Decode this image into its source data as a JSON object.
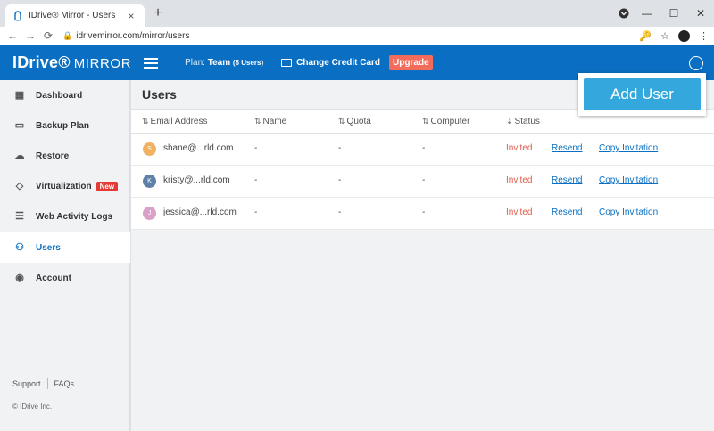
{
  "browser": {
    "tab_title": "IDrive® Mirror - Users",
    "tab_close": "×",
    "new_tab": "+",
    "url": "idrivemirror.com/mirror/users",
    "window_minimize": "—",
    "window_maximize": "☐",
    "window_close": "✕",
    "back": "←",
    "forward": "→",
    "reload": "⟳",
    "key_icon": "🔑",
    "star_icon": "☆",
    "menu_icon": "⋮"
  },
  "header": {
    "logo_main": "IDrive®",
    "logo_sub": "MIRROR",
    "plan_label": "Plan:",
    "plan_name": "Team",
    "plan_users": "(5 Users)",
    "change_card": "Change Credit Card",
    "upgrade": "Upgrade"
  },
  "sidebar": {
    "items": [
      {
        "label": "Dashboard",
        "icon": "dashboard-icon"
      },
      {
        "label": "Backup Plan",
        "icon": "monitor-icon"
      },
      {
        "label": "Restore",
        "icon": "cloud-icon"
      },
      {
        "label": "Virtualization",
        "icon": "cube-icon",
        "badge": "New"
      },
      {
        "label": "Web Activity Logs",
        "icon": "logs-icon"
      },
      {
        "label": "Users",
        "icon": "users-icon",
        "active": true
      },
      {
        "label": "Account",
        "icon": "account-icon"
      }
    ],
    "support": "Support",
    "faqs": "FAQs",
    "copyright": "© IDrive Inc."
  },
  "main": {
    "title": "Users",
    "add_user": "Add User",
    "columns": [
      "Email Address",
      "Name",
      "Quota",
      "Computer",
      "Status"
    ],
    "rows": [
      {
        "initial": "S",
        "avatar_color": "#f0b160",
        "email": "shane@...rld.com",
        "name": "-",
        "quota": "-",
        "computer": "-",
        "status": "Invited",
        "resend": "Resend",
        "copy": "Copy Invitation"
      },
      {
        "initial": "K",
        "avatar_color": "#5d7fa8",
        "email": "kristy@...rld.com",
        "name": "-",
        "quota": "-",
        "computer": "-",
        "status": "Invited",
        "resend": "Resend",
        "copy": "Copy Invitation"
      },
      {
        "initial": "J",
        "avatar_color": "#d9a0c8",
        "email": "jessica@...rld.com",
        "name": "-",
        "quota": "-",
        "computer": "-",
        "status": "Invited",
        "resend": "Resend",
        "copy": "Copy Invitation"
      }
    ]
  },
  "colors": {
    "brand": "#0a6fc2",
    "upgrade": "#f26b5b",
    "add_user": "#34a8dc",
    "status_invited": "#e05a4a"
  }
}
